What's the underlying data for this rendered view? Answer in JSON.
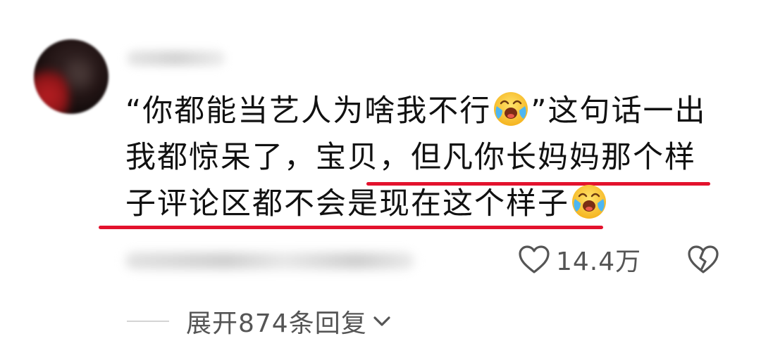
{
  "comment": {
    "username": "",
    "text_line1_a": "“你都能当艺人为啥我不行",
    "text_line1_b": "”这句话一出",
    "text_line2": "我都惊呆了，宝贝，但凡你长妈妈那个样",
    "text_line3": "子评论区都不会是现在这个样子",
    "emoji_name": "crying-laughing-emoji",
    "meta": "",
    "like_count": "14.4万",
    "replies_label": "展开874条回复",
    "underline_color": "#e3122d"
  }
}
